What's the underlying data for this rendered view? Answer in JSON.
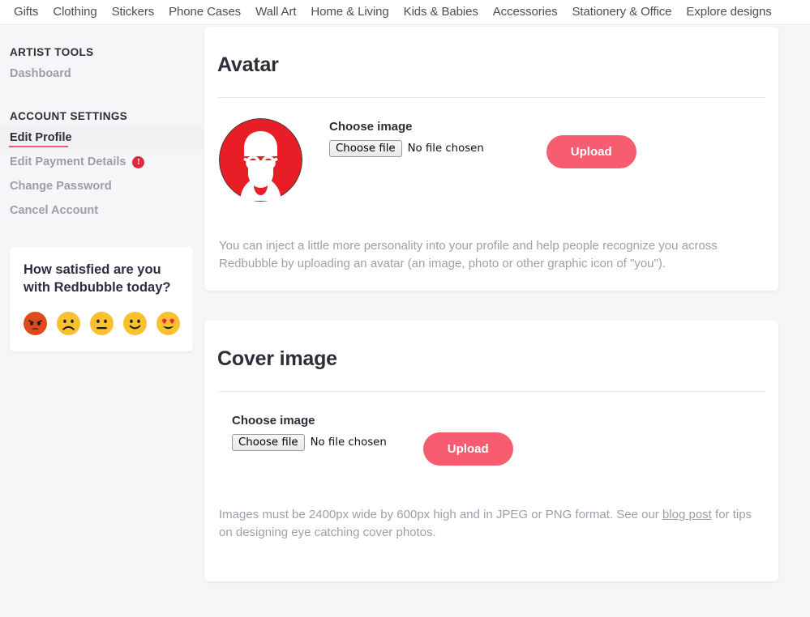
{
  "topnav": {
    "items": [
      {
        "label": "Gifts"
      },
      {
        "label": "Clothing"
      },
      {
        "label": "Stickers"
      },
      {
        "label": "Phone Cases"
      },
      {
        "label": "Wall Art"
      },
      {
        "label": "Home & Living"
      },
      {
        "label": "Kids & Babies"
      },
      {
        "label": "Accessories"
      },
      {
        "label": "Stationery & Office"
      },
      {
        "label": "Explore designs"
      }
    ]
  },
  "sidebar": {
    "groups": [
      {
        "title": "ARTIST TOOLS",
        "items": [
          {
            "label": "Dashboard",
            "active": false,
            "badge": null
          }
        ]
      },
      {
        "title": "ACCOUNT SETTINGS",
        "items": [
          {
            "label": "Edit Profile",
            "active": true,
            "badge": null
          },
          {
            "label": "Edit Payment Details",
            "active": false,
            "badge": "!"
          },
          {
            "label": "Change Password",
            "active": false,
            "badge": null
          },
          {
            "label": "Cancel Account",
            "active": false,
            "badge": null
          }
        ]
      }
    ],
    "survey": {
      "question": "How satisfied are you with Redbubble today?",
      "faces": [
        {
          "name": "angry-face",
          "color": "#e0491a",
          "mood": "angry"
        },
        {
          "name": "frowning-face",
          "color": "#fbc02d",
          "mood": "sad"
        },
        {
          "name": "neutral-face",
          "color": "#fbc02d",
          "mood": "neutral"
        },
        {
          "name": "slightly-smiling-face",
          "color": "#fbc02d",
          "mood": "happy"
        },
        {
          "name": "heart-eyes-face",
          "color": "#fbc02d",
          "mood": "love"
        }
      ]
    }
  },
  "avatar_section": {
    "title": "Avatar",
    "choose_label": "Choose image",
    "file_button": "Choose file",
    "file_status": "No file chosen",
    "upload_button": "Upload",
    "help_text": "You can inject a little more personality into your profile and help people recognize you across Redbubble by uploading an avatar (an image, photo or other graphic icon of \"you\").",
    "avatar_bg_color": "#e81d25"
  },
  "cover_section": {
    "title": "Cover image",
    "choose_label": "Choose image",
    "file_button": "Choose file",
    "file_status": "No file chosen",
    "upload_button": "Upload",
    "help_text_before": "Images must be 2400px wide by 600px high and in JPEG or PNG format. See our ",
    "help_link": "blog post",
    "help_text_after": " for tips on designing eye catching cover photos."
  },
  "theme": {
    "accent": "#f75c71",
    "underline_accent": "#f1586e",
    "alert_red": "#e2283c",
    "page_bg": "#f6f6f8",
    "muted_text": "#9ba0ab"
  }
}
